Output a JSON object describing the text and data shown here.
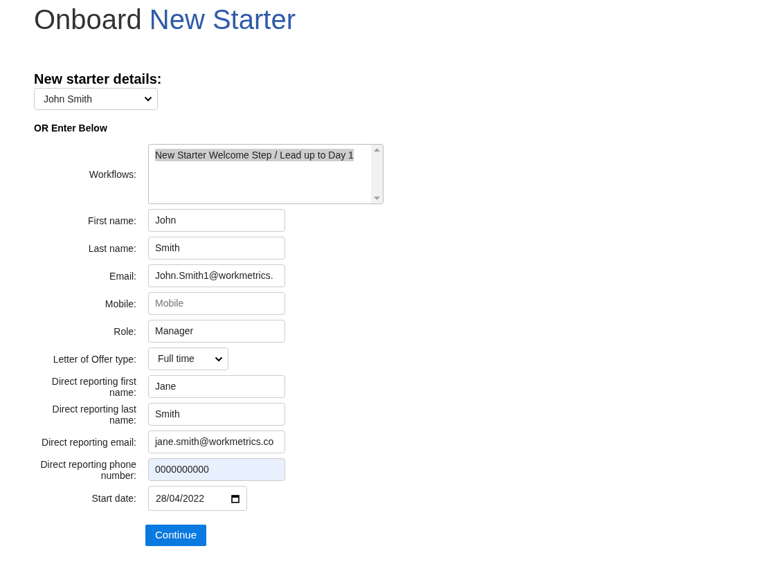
{
  "title": {
    "prefix": "Onboard",
    "highlight": "New Starter"
  },
  "starter": {
    "heading": "New starter details:",
    "value": "John Smith"
  },
  "or_label": "OR Enter Below",
  "fields": [
    {
      "kind": "listbox",
      "label": "Workflows:",
      "options": [
        {
          "text": "New Starter Welcome Step / Lead up to Day 1",
          "selected": true
        }
      ]
    },
    {
      "kind": "text",
      "label": "First name:",
      "value": "John",
      "autofilled": false
    },
    {
      "kind": "text",
      "label": "Last name:",
      "value": "Smith",
      "autofilled": false
    },
    {
      "kind": "text",
      "label": "Email:",
      "value": "John.Smith1@workmetrics.",
      "autofilled": false
    },
    {
      "kind": "text",
      "label": "Mobile:",
      "placeholder": "Mobile",
      "autofilled": false
    },
    {
      "kind": "text",
      "label": "Role:",
      "value": "Manager",
      "autofilled": false
    },
    {
      "kind": "select",
      "label": "Letter of Offer type:",
      "value": "Full time"
    },
    {
      "kind": "text",
      "label": "Direct reporting first name:",
      "value": "Jane",
      "autofilled": false
    },
    {
      "kind": "text",
      "label": "Direct reporting last name:",
      "value": "Smith",
      "autofilled": false
    },
    {
      "kind": "text",
      "label": "Direct reporting email:",
      "value": "jane.smith@workmetrics.co",
      "autofilled": false
    },
    {
      "kind": "text",
      "label": "Direct reporting phone number:",
      "value": "0000000000",
      "autofilled": true
    },
    {
      "kind": "date",
      "label": "Start date:",
      "value": "28/04/2022"
    }
  ],
  "submit": "Continue"
}
